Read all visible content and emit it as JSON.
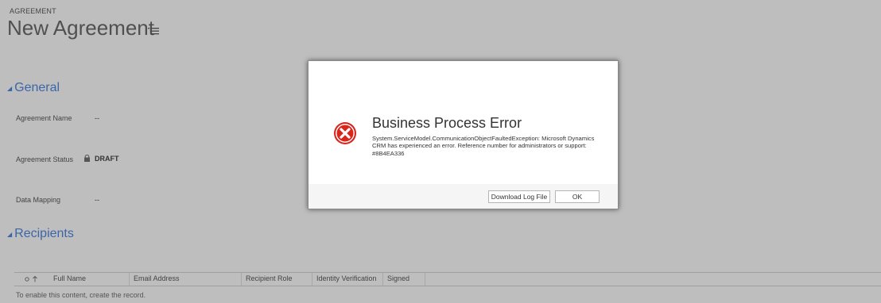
{
  "header": {
    "entity_label": "AGREEMENT",
    "record_title": "New Agreement",
    "menu_icon": "hamburger-menu-icon"
  },
  "sections": {
    "general": {
      "label": "General",
      "collapse_icon": "triangle-down-icon"
    },
    "recipients": {
      "label": "Recipients",
      "collapse_icon": "triangle-down-icon"
    }
  },
  "fields": {
    "agreement_name": {
      "label": "Agreement Name",
      "value": "--"
    },
    "agreement_status": {
      "label": "Agreement Status",
      "value": "DRAFT",
      "lock_icon": "lock-icon"
    },
    "data_mapping": {
      "label": "Data Mapping",
      "value": "--"
    }
  },
  "grid": {
    "select_icon": "circle-select-icon",
    "sort_icon": "sort-up-arrow-icon",
    "columns": [
      "Full Name",
      "Email Address",
      "Recipient Role",
      "Identity Verification",
      "Signed"
    ],
    "empty_message": "To enable this content, create the record."
  },
  "dialog": {
    "icon": "error-x-icon",
    "title": "Business Process Error",
    "message": "System.ServiceModel.CommunicationObjectFaultedException: Microsoft Dynamics CRM has experienced an error. Reference number for administrators or support: #8B4EA336",
    "download_label": "Download Log File",
    "ok_label": "OK",
    "error_color": "#d9261c"
  }
}
